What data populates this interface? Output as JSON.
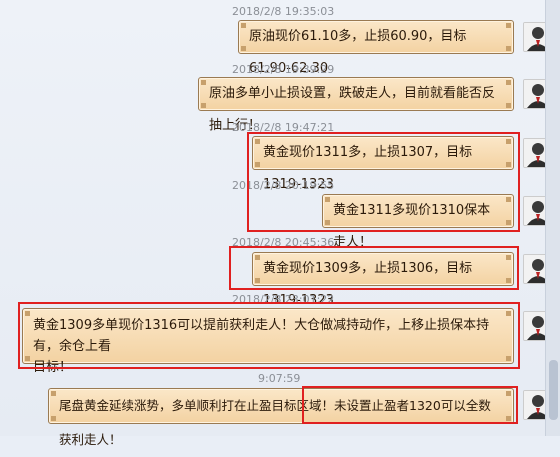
{
  "messages": [
    {
      "time": "2018/2/8 19:35:03",
      "text": "原油现价61.10多，止损60.90，目标61.90-62.30"
    },
    {
      "time": "2018/2/8 19:39:29",
      "text": "原油多单小止损设置，跌破走人，目前就看能否反抽上行！"
    },
    {
      "time": "2018/2/8 19:47:21",
      "text": "黄金现价1311多，止损1307，目标1319-1323"
    },
    {
      "time": "2018/2/8 20:19:55",
      "text": "黄金1311多现价1310保本走人！"
    },
    {
      "time": "2018/2/8 20:45:36",
      "text": "黄金现价1309多，止损1306，目标1319-1323"
    },
    {
      "time": "2018/2/8 23:01:22",
      "text_line1": "黄金1309多单现价1316可以提前获利走人！大仓做减持动作，上移止损保本持有，余仓上看",
      "text_line2": "目标！"
    },
    {
      "time": "9:07:59",
      "text": "尾盘黄金延续涨势，多单顺利打在止盈目标区域！未设置止盈者1320可以全数获利走人！"
    }
  ]
}
